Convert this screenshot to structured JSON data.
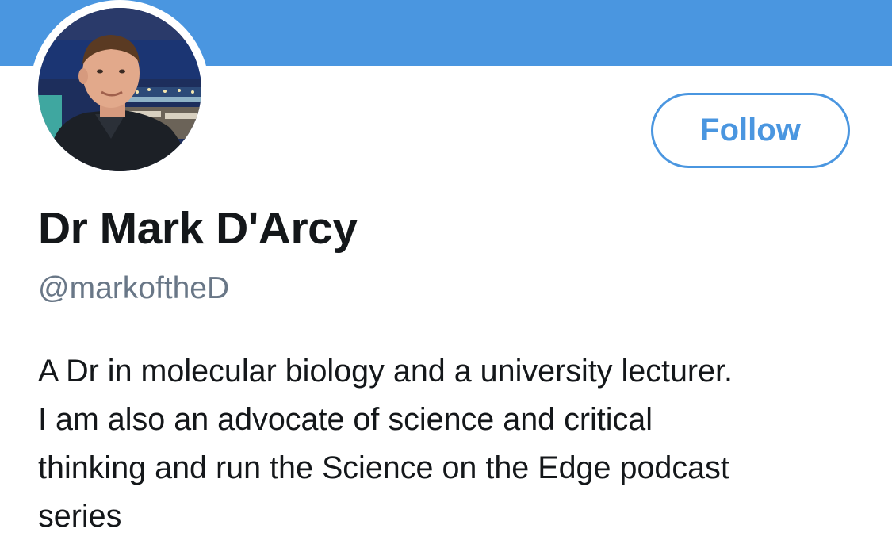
{
  "profile": {
    "display_name": "Dr Mark D'Arcy",
    "handle": "@markoftheD",
    "follow_label": "Follow",
    "bio_lines": [
      "A Dr in molecular biology and a university lecturer.",
      "I am also an advocate of science and critical",
      "thinking and run the Science on the Edge podcast",
      "series"
    ]
  },
  "colors": {
    "banner": "#4a96e0",
    "accent": "#4a96e0",
    "name_text": "#14171a",
    "handle_text": "#697787"
  },
  "icons": {
    "avatar": "profile-photo-avatar"
  }
}
